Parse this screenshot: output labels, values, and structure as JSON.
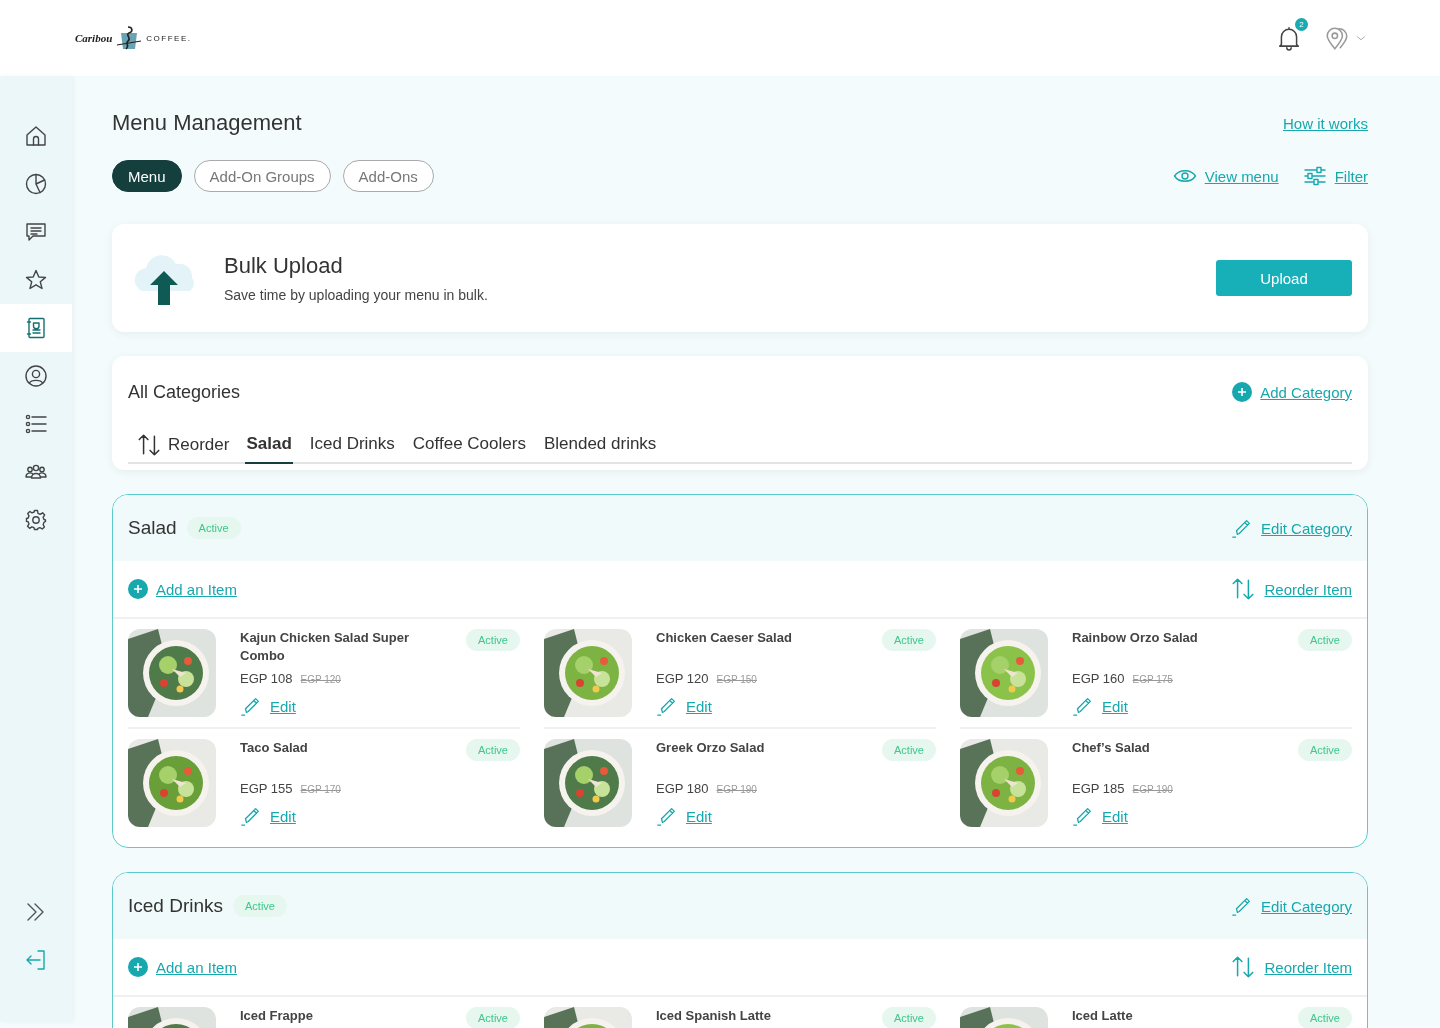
{
  "header": {
    "logo": {
      "script": "Caribou",
      "word": "COFFEE."
    },
    "notifications": {
      "count": "2"
    }
  },
  "sidebar": {
    "items": [
      {
        "selected": false
      },
      {
        "selected": false
      },
      {
        "selected": false
      },
      {
        "selected": false
      },
      {
        "selected": true
      },
      {
        "selected": false
      },
      {
        "selected": false
      },
      {
        "selected": false
      },
      {
        "selected": false
      }
    ]
  },
  "page": {
    "title": "Menu Management",
    "help_link": "How it works"
  },
  "tabs": [
    {
      "label": "Menu",
      "selected": true
    },
    {
      "label": "Add-On Groups",
      "selected": false
    },
    {
      "label": "Add-Ons",
      "selected": false
    }
  ],
  "actions": {
    "view_menu": "View menu",
    "filter": "Filter"
  },
  "bulk_upload": {
    "title": "Bulk Upload",
    "description": "Save time by uploading your menu in bulk.",
    "button": "Upload"
  },
  "categories": {
    "title": "All Categories",
    "add_link": "Add Category",
    "reorder": "Reorder",
    "tabs": [
      {
        "label": "Salad",
        "selected": true
      },
      {
        "label": "Iced Drinks",
        "selected": false
      },
      {
        "label": "Coffee Coolers",
        "selected": false
      },
      {
        "label": "Blended drinks",
        "selected": false
      }
    ]
  },
  "sections": [
    {
      "title": "Salad",
      "status": "Active",
      "edit_link": "Edit Category",
      "add_item": "Add an Item",
      "reorder_item": "Reorder Item",
      "items": [
        {
          "name": "Kajun Chicken Salad Super Combo",
          "status": "Active",
          "price": "EGP 108",
          "old_price": "EGP 120",
          "edit": "Edit"
        },
        {
          "name": "Chicken Caeser Salad",
          "status": "Active",
          "price": "EGP 120",
          "old_price": "EGP 150",
          "edit": "Edit"
        },
        {
          "name": "Rainbow Orzo Salad",
          "status": "Active",
          "price": "EGP 160",
          "old_price": "EGP 175",
          "edit": "Edit"
        },
        {
          "name": "Taco Salad",
          "status": "Active",
          "price": "EGP 155",
          "old_price": "EGP 170",
          "edit": "Edit"
        },
        {
          "name": "Greek Orzo Salad",
          "status": "Active",
          "price": "EGP 180",
          "old_price": "EGP 190",
          "edit": "Edit"
        },
        {
          "name": "Chef’s Salad",
          "status": "Active",
          "price": "EGP 185",
          "old_price": "EGP 190",
          "edit": "Edit"
        }
      ]
    },
    {
      "title": "Iced Drinks",
      "status": "Active",
      "edit_link": "Edit Category",
      "add_item": "Add an Item",
      "reorder_item": "Reorder Item",
      "items": [
        {
          "name": "Iced Frappe",
          "status": "Active"
        },
        {
          "name": "Iced Spanish Latte",
          "status": "Active"
        },
        {
          "name": "Iced Latte",
          "status": "Active"
        }
      ]
    }
  ]
}
